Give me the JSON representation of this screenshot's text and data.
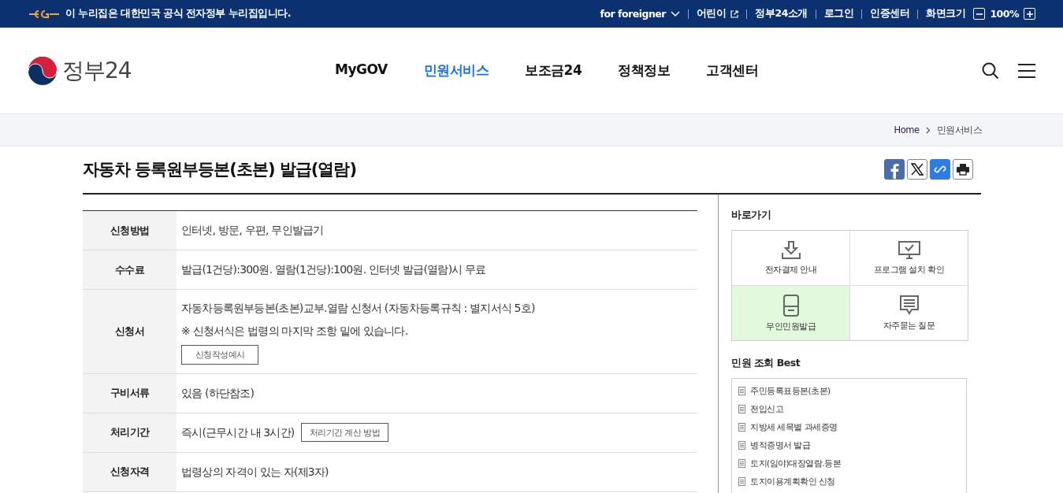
{
  "top_bar": {
    "notice": "이 누리집은 대한민국 공식 전자정부 누리집입니다.",
    "links": [
      {
        "label": "for foreigner",
        "kind": "dropdown"
      },
      {
        "label": "어린이",
        "kind": "external"
      },
      {
        "label": "정부24소개",
        "kind": "plain"
      },
      {
        "label": "로그인",
        "kind": "plain"
      },
      {
        "label": "인증센터",
        "kind": "plain"
      },
      {
        "label": "화면크기",
        "kind": "plain"
      }
    ],
    "zoom": "100%"
  },
  "header": {
    "logo": "정부24",
    "nav": [
      {
        "label": "MyGOV",
        "selected": false
      },
      {
        "label": "민원서비스",
        "selected": true
      },
      {
        "label": "보조금24",
        "selected": false
      },
      {
        "label": "정책정보",
        "selected": false
      },
      {
        "label": "고객센터",
        "selected": false
      }
    ]
  },
  "breadcrumb": [
    "Home",
    "민원서비스"
  ],
  "title": "자동차 등록원부등본(초본) 발급(열람)",
  "info_table": [
    {
      "label": "신청방법",
      "lines": [
        "인터넷, 방문, 우편, 무인발급기"
      ]
    },
    {
      "label": "수수료",
      "lines": [
        "발급(1건당):300원. 열람(1건당):100원. 인터넷 발급(열람)시 무료"
      ]
    },
    {
      "label": "신청서",
      "lines": [
        "자동차등록원부등본(초본)교부.열람 신청서 (자동차등록규칙 : 별지서식 5호)",
        "※ 신청서식은 법령의 마지막 조항 밑에 있습니다."
      ],
      "button": "신청작성예시",
      "button_inline": false
    },
    {
      "label": "구비서류",
      "lines": [
        "있음 (하단참조)"
      ]
    },
    {
      "label": "처리기간",
      "lines": [
        "즉시(근무시간 내 3시간)"
      ],
      "button": "처리기간 계산 방법",
      "button_inline": true
    },
    {
      "label": "신청자격",
      "lines": [
        "법령상의 자격이 있는 자(제3자)"
      ]
    }
  ],
  "sidebar": {
    "shortcuts_title": "바로가기",
    "shortcuts": [
      {
        "label": "전자결제 안내",
        "kind": "download",
        "selected": false
      },
      {
        "label": "프로그램 설치 확인",
        "kind": "monitor",
        "selected": false
      },
      {
        "label": "무인민원발급",
        "kind": "kiosk",
        "selected": true
      },
      {
        "label": "자주묻는 질문",
        "kind": "chat",
        "selected": false
      }
    ],
    "best_title": "민원 조회 Best",
    "best": [
      "주민등록표등본(초본)",
      "전입신고",
      "지방세 세목별 과세증명",
      "병적증명서 발급",
      "토지(임야)대장열람.등본",
      "토지이용계획확인 신청"
    ]
  }
}
